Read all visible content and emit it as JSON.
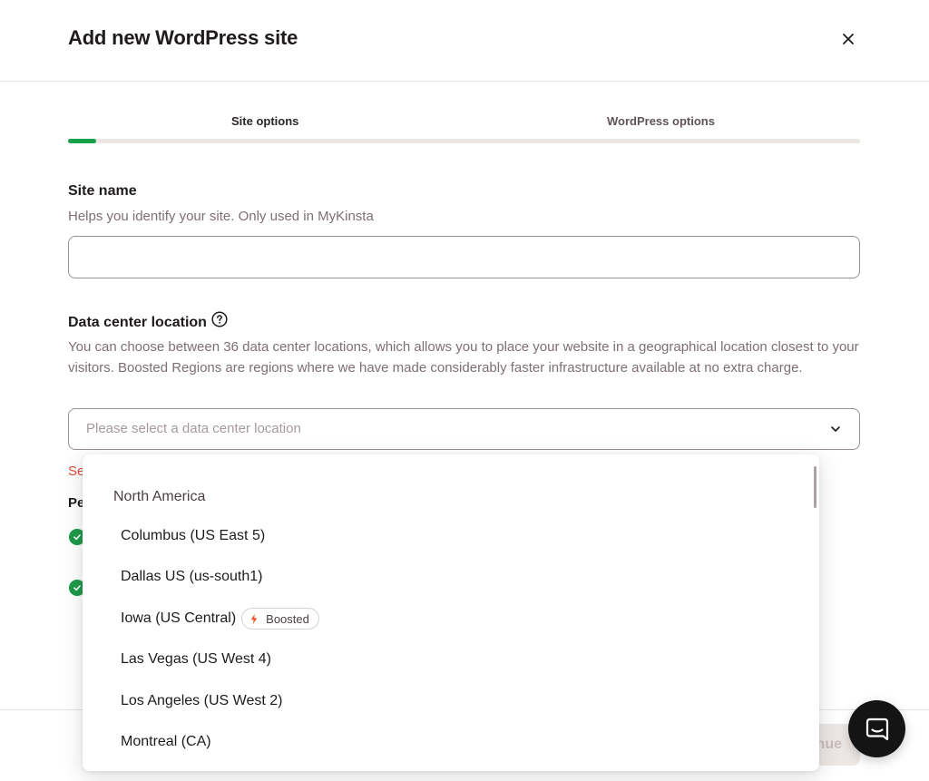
{
  "modal": {
    "title": "Add new WordPress site"
  },
  "steps": {
    "items": [
      {
        "label": "Site options"
      },
      {
        "label": "WordPress options"
      }
    ],
    "progress_fraction": 0.035
  },
  "site_name": {
    "label": "Site name",
    "help": "Helps you identify your site. Only used in MyKinsta",
    "value": "",
    "placeholder": ""
  },
  "data_center": {
    "label": "Data center location",
    "help": "You can choose between 36 data center locations, which allows you to place your website in a geographical location closest to your visitors. Boosted Regions are regions where we have made considerably faster infrastructure available at no extra charge.",
    "placeholder": "Please select a data center location"
  },
  "obscured": {
    "error_fragment": "Se",
    "section_fragment": "Pe"
  },
  "dropdown": {
    "group": "North America",
    "options": [
      {
        "label": "Columbus (US East 5)"
      },
      {
        "label": "Dallas US (us-south1)"
      },
      {
        "label": "Iowa (US Central)",
        "badge": "Boosted"
      },
      {
        "label": "Las Vegas (US West 4)"
      },
      {
        "label": "Los Angeles (US West 2)"
      },
      {
        "label": "Montreal (CA)"
      }
    ]
  },
  "footer": {
    "continue_label_visible": "nue"
  },
  "colors": {
    "accent_green": "#18a14b",
    "boosted_orange": "#f0562a",
    "error_red": "#e04b3c",
    "chat_button": "#141414"
  },
  "icons": {
    "close": "close-icon",
    "help": "question-circle-icon",
    "chevron": "chevron-down-icon",
    "check": "check-circle-icon",
    "boosted": "lightning-icon",
    "chat": "chat-icon"
  }
}
